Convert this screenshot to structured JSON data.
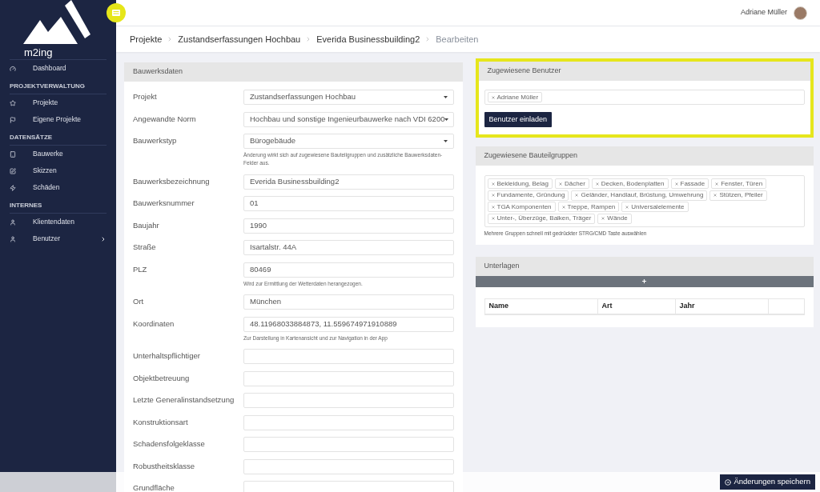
{
  "sidebar": {
    "brand": "m2ing",
    "groups": [
      {
        "items": [
          {
            "label": "Dashboard",
            "kind": "link"
          }
        ]
      },
      {
        "heading": "PROJEKTVERWALTUNG",
        "items": [
          {
            "label": "Projekte",
            "kind": "link"
          },
          {
            "label": "Eigene Projekte",
            "kind": "link"
          }
        ]
      },
      {
        "heading": "DATENSÄTZE",
        "items": [
          {
            "label": "Bauwerke",
            "kind": "link"
          },
          {
            "label": "Skizzen",
            "kind": "link"
          },
          {
            "label": "Schäden",
            "kind": "link"
          }
        ]
      },
      {
        "heading": "INTERNES",
        "items": [
          {
            "label": "Klientendaten",
            "kind": "link"
          },
          {
            "label": "Benutzer",
            "kind": "submenu"
          }
        ]
      }
    ]
  },
  "header": {
    "user": "Adriane Müller"
  },
  "breadcrumb": [
    {
      "label": "Projekte",
      "current": false
    },
    {
      "label": "Zustandserfassungen Hochbau",
      "current": false
    },
    {
      "label": "Everida Businessbuilding2",
      "current": false
    },
    {
      "label": "Bearbeiten",
      "current": true
    }
  ],
  "building_data": {
    "title": "Bauwerksdaten",
    "fields": [
      {
        "label": "Projekt",
        "kind": "select",
        "value": "Zustandserfassungen Hochbau"
      },
      {
        "label": "Angewandte Norm",
        "kind": "select",
        "value": "Hochbau und sonstige Ingenieurbauwerke nach VDI 6200"
      },
      {
        "label": "Bauwerkstyp",
        "kind": "select",
        "value": "Bürogebäude",
        "help": "Änderung wirkt sich auf zugewiesene Bauteilgruppen und zusätzliche Bauwerksdaten-Felder aus."
      },
      {
        "label": "Bauwerksbezeichnung",
        "kind": "text",
        "value": "Everida Businessbuilding2"
      },
      {
        "label": "Bauwerksnummer",
        "kind": "text",
        "value": "01"
      },
      {
        "label": "Baujahr",
        "kind": "text",
        "value": "1990"
      },
      {
        "label": "Straße",
        "kind": "text",
        "value": "Isartalstr. 44A"
      },
      {
        "label": "PLZ",
        "kind": "text",
        "value": "80469",
        "help": "Wird zur Ermittlung der Wetterdaten herangezogen."
      },
      {
        "label": "Ort",
        "kind": "text",
        "value": "München"
      },
      {
        "label": "Koordinaten",
        "kind": "text",
        "value": "48.11968033884873, 11.559674971910889",
        "help": "Zur Darstellung in Kartenansicht und zur Navigation in der App"
      },
      {
        "label": "Unterhaltspflichtiger",
        "kind": "text"
      },
      {
        "label": "Objektbetreuung",
        "kind": "text"
      },
      {
        "label": "Letzte Generalinstandsetzung",
        "kind": "text"
      },
      {
        "label": "Konstruktionsart",
        "kind": "text"
      },
      {
        "label": "Schadensfolgeklasse",
        "kind": "text"
      },
      {
        "label": "Robustheitsklasse",
        "kind": "text"
      },
      {
        "label": "Grundfläche",
        "kind": "text"
      }
    ]
  },
  "assigned_users": {
    "title": "Zugewiesene Benutzer",
    "highlighted": true,
    "tags": [
      "Adriane Müller"
    ],
    "button": "Benutzer einladen"
  },
  "assigned_groups": {
    "title": "Zugewiesene Bauteilgruppen",
    "tags": [
      "Bekleidung, Belag",
      "Dächer",
      "Decken, Bodenplatten",
      "Fassade",
      "Fenster, Türen",
      "Fundamente, Gründung",
      "Geländer, Handlauf, Brüstung, Umwehrung",
      "Stützen, Pfeiler",
      "TGA Komponenten",
      "Treppe, Rampen",
      "Universalelemente",
      "Unter-, Überzüge, Balken, Träger",
      "Wände"
    ],
    "help": "Mehrere Gruppen schnell mit gedrückter STRG/CMD Taste auswählen"
  },
  "documents": {
    "title": "Unterlagen",
    "columns": [
      "Name",
      "Art",
      "Jahr"
    ]
  },
  "save_button": "Änderungen speichern"
}
